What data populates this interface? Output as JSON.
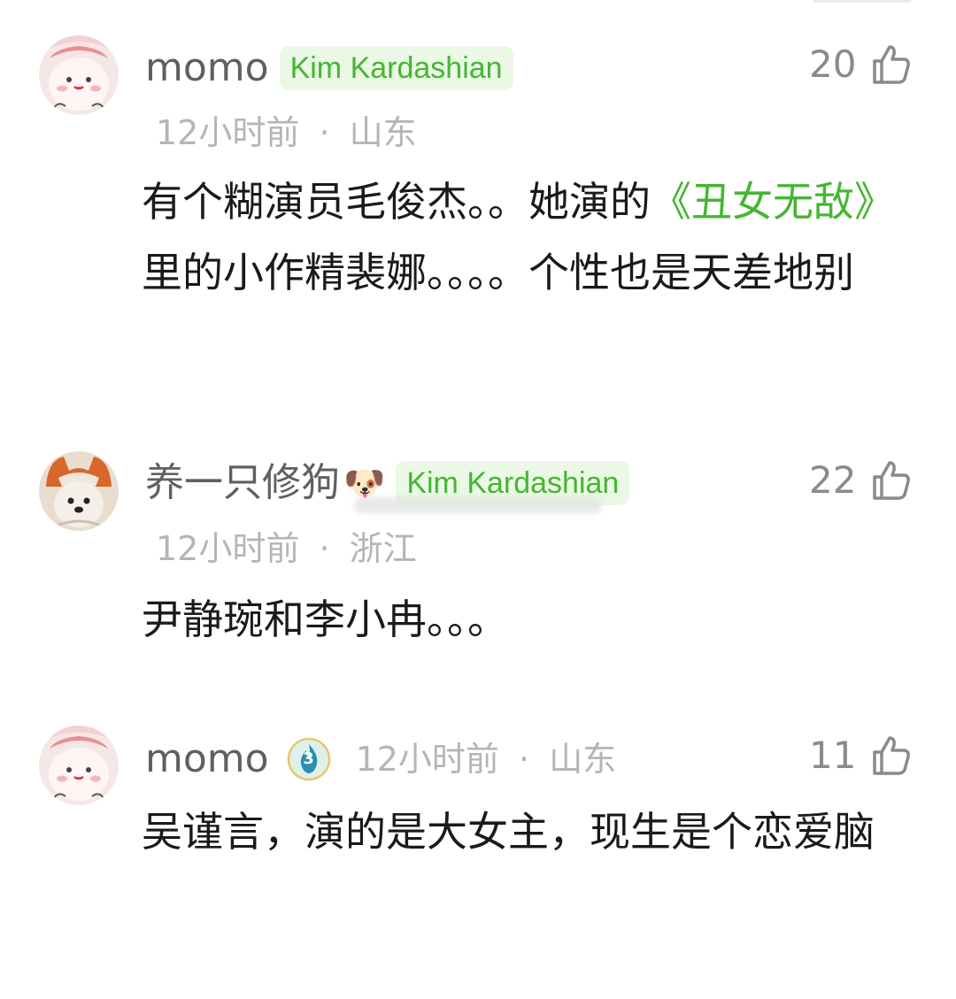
{
  "comments": [
    {
      "username": "momo",
      "tag": "Kim Kardashian",
      "time": "12小时前",
      "location": "山东",
      "likes": "20",
      "text_before": "有个糊演员毛俊杰。。她演的",
      "text_highlight": "《丑女无敌》",
      "text_after": "里的小作精裴娜。。。。个性也是天差地别"
    },
    {
      "username": "养一只修狗",
      "username_emoji": "🐶",
      "tag": "Kim Kardashian",
      "time": "12小时前",
      "location": "浙江",
      "likes": "22",
      "text": "尹静琬和李小冉。。。"
    },
    {
      "username": "momo",
      "badge_level": "3",
      "time": "12小时前",
      "location": "山东",
      "likes": "11",
      "text": "吴谨言，演的是大女主，现生是个恋爱脑"
    }
  ],
  "meta_separator": "·",
  "icons": {
    "like": "thumbs-up-icon",
    "badge": "flame-level-badge-icon"
  },
  "colors": {
    "tag_text": "#45b631",
    "tag_bg": "#eaf8e5",
    "meta": "#b5b5b5",
    "username": "#5f5f5f",
    "link_green": "#45b631"
  }
}
